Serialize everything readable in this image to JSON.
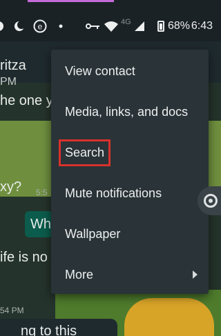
{
  "status_bar": {
    "network_label": "4G",
    "battery_percent": "68%",
    "time": "6:43"
  },
  "chat": {
    "contact_name_partial": "ritza",
    "time_partial": "PM",
    "message_1_partial": "he one y",
    "message_2_partial": "xy?",
    "message_2_time_partial": "5:5",
    "outgoing_partial": "Wh",
    "message_3_partial": "ife is no",
    "message_4_time_partial": "54 PM",
    "message_5_partial": "ng to this article"
  },
  "menu": {
    "items": [
      {
        "label": "View contact"
      },
      {
        "label": "Media, links, and docs"
      },
      {
        "label": "Search"
      },
      {
        "label": "Mute notifications"
      },
      {
        "label": "Wallpaper"
      },
      {
        "label": "More"
      }
    ],
    "highlighted_item": "Search",
    "highlight_color": "#d8322c"
  },
  "icons": {
    "status_left": [
      "camera-icon",
      "moon-icon",
      "e-app-icon",
      "dot-icon"
    ],
    "status_right": [
      "key-icon",
      "wifi-icon",
      "signal-icon",
      "battery-icon"
    ],
    "more_submenu": "chevron-right-icon",
    "floating_button": "camera-shutter-icon"
  }
}
